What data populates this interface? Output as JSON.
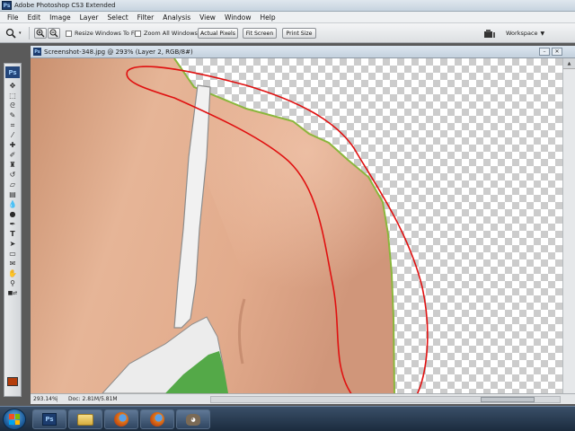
{
  "app": {
    "title": "Adobe Photoshop CS3 Extended",
    "icon": "photoshop-icon",
    "badge_text": "Ps"
  },
  "menu": [
    "File",
    "Edit",
    "Image",
    "Layer",
    "Select",
    "Filter",
    "Analysis",
    "View",
    "Window",
    "Help"
  ],
  "options_bar": {
    "current_tool_icon": "zoom-tool-icon",
    "resize_windows_label": "Resize Windows To Fit",
    "zoom_all_windows_label": "Zoom All Windows",
    "actual_pixels_label": "Actual Pixels",
    "fit_screen_label": "Fit Screen",
    "print_size_label": "Print Size",
    "workspace_label": "Workspace"
  },
  "document": {
    "tab_title": "Screenshot-348.jpg @ 293% (Layer 2, RGB/8#)",
    "zoom": "293.14%",
    "doc_info": "Doc: 2.81M/5.81M"
  },
  "toolbox": {
    "logo_text": "Ps",
    "tools": [
      "move",
      "marquee",
      "lasso",
      "quick-select",
      "crop",
      "eyedropper",
      "healing-brush",
      "brush",
      "clone-stamp",
      "history-brush",
      "eraser",
      "gradient",
      "blur",
      "dodge",
      "pen",
      "type",
      "path-select",
      "shape",
      "notes",
      "hand",
      "zoom"
    ],
    "foreground_color": "#b43d0b"
  },
  "taskbar": {
    "items": [
      "photoshop",
      "explorer",
      "firefox",
      "firefox",
      "gimp"
    ],
    "gimp_badge": "wilber"
  },
  "colors": {
    "annotation": "#e01010",
    "selection_edge": "#8ab63c",
    "skin": "#e0ad8e",
    "top_green": "#54a948"
  }
}
